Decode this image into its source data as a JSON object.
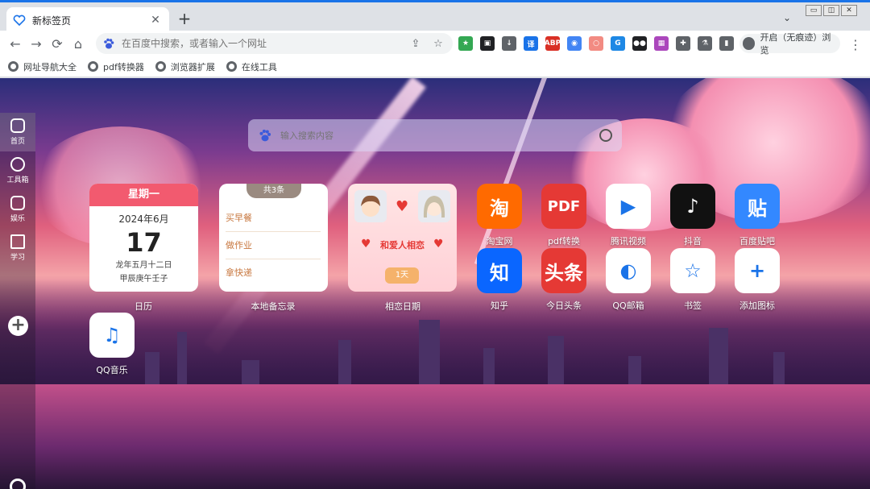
{
  "browser": {
    "tab_title": "新标签页",
    "tab_close": "✕",
    "new_tab": "+",
    "tab_menu": "⌄",
    "omnibox_placeholder": "在百度中搜索，或者输入一个网址",
    "profile_label": "开启（无痕迹）浏览",
    "window_controls": [
      "▭",
      "◫",
      "✕"
    ]
  },
  "nav": {
    "back": "←",
    "forward": "→",
    "reload": "⟳",
    "home": "⌂",
    "share": "⇪",
    "star": "☆",
    "kebab": "⋮"
  },
  "extensions": [
    {
      "name": "star-ext-icon",
      "label": "★",
      "color": "#34a853"
    },
    {
      "name": "qr-ext-icon",
      "label": "▣",
      "color": "#202124"
    },
    {
      "name": "download-icon",
      "label": "↓",
      "color": "#5f6368"
    },
    {
      "name": "translate-ext-icon",
      "label": "译",
      "color": "#1a73e8"
    },
    {
      "name": "abp-ext-icon",
      "label": "ABP",
      "color": "#d93025"
    },
    {
      "name": "camera-ext-icon",
      "label": "◉",
      "color": "#4285f4"
    },
    {
      "name": "ring-ext-icon",
      "label": "○",
      "color": "#f28b82"
    },
    {
      "name": "cloud-ext-icon",
      "label": "G",
      "color": "#1e88e5"
    },
    {
      "name": "eyes-ext-icon",
      "label": "●●",
      "color": "#202124"
    },
    {
      "name": "palette-ext-icon",
      "label": "▦",
      "color": "#ab47bc"
    },
    {
      "name": "puzzle-icon",
      "label": "✚",
      "color": "#5f6368"
    },
    {
      "name": "flask-icon",
      "label": "⚗",
      "color": "#5f6368"
    },
    {
      "name": "sidepanel-icon",
      "label": "▮",
      "color": "#5f6368"
    }
  ],
  "bookmarks": [
    "网址导航大全",
    "pdf转换器",
    "浏览器扩展",
    "在线工具"
  ],
  "sidebar": [
    {
      "label": "首页",
      "active": true
    },
    {
      "label": "工具箱",
      "active": false
    },
    {
      "label": "娱乐",
      "active": false
    },
    {
      "label": "学习",
      "active": false
    }
  ],
  "sidebar_add": "+",
  "search": {
    "placeholder": "输入搜索内容"
  },
  "calendar": {
    "weekday": "星期一",
    "year_month": "2024年6月",
    "day": "17",
    "lunar_1": "龙年五月十二日",
    "lunar_2": "甲辰庚午壬子",
    "caption": "日历"
  },
  "memo": {
    "badge": "共3条",
    "items": [
      "买早餐",
      "做作业",
      "拿快递"
    ],
    "caption": "本地备忘录"
  },
  "love": {
    "title": "和爱人相恋",
    "days": "1天",
    "caption": "相恋日期",
    "heart": "♥"
  },
  "apps": [
    {
      "name": "淘宝网",
      "glyph": "淘",
      "color": "#ff6a00"
    },
    {
      "name": "pdf转换",
      "glyph": "PDF",
      "color": "#e53935"
    },
    {
      "name": "腾讯视频",
      "glyph": "▶",
      "color": "#ffffff"
    },
    {
      "name": "抖音",
      "glyph": "♪",
      "color": "#111111"
    },
    {
      "name": "百度贴吧",
      "glyph": "贴",
      "color": "#3388ff"
    },
    {
      "name": "知乎",
      "glyph": "知",
      "color": "#0a66ff"
    },
    {
      "name": "今日头条",
      "glyph": "头条",
      "color": "#e53935"
    },
    {
      "name": "QQ邮箱",
      "glyph": "◐",
      "color": "#ffffff"
    },
    {
      "name": "书签",
      "glyph": "☆",
      "color": "#ffffff"
    },
    {
      "name": "添加图标",
      "glyph": "+",
      "color": "#ffffff"
    },
    {
      "name": "QQ音乐",
      "glyph": "♫",
      "color": "#ffffff"
    }
  ]
}
